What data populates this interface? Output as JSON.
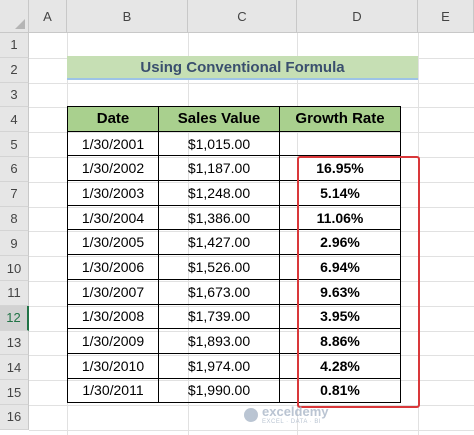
{
  "columns": [
    "A",
    "B",
    "C",
    "D",
    "E"
  ],
  "rows": [
    "1",
    "2",
    "3",
    "4",
    "5",
    "6",
    "7",
    "8",
    "9",
    "10",
    "11",
    "12",
    "13",
    "14",
    "15",
    "16"
  ],
  "selected_row": "12",
  "title": "Using Conventional Formula",
  "table": {
    "headers": [
      "Date",
      "Sales Value",
      "Growth Rate"
    ],
    "rows": [
      {
        "date": "1/30/2001",
        "sales": "$1,015.00",
        "growth": ""
      },
      {
        "date": "1/30/2002",
        "sales": "$1,187.00",
        "growth": "16.95%"
      },
      {
        "date": "1/30/2003",
        "sales": "$1,248.00",
        "growth": "5.14%"
      },
      {
        "date": "1/30/2004",
        "sales": "$1,386.00",
        "growth": "11.06%"
      },
      {
        "date": "1/30/2005",
        "sales": "$1,427.00",
        "growth": "2.96%"
      },
      {
        "date": "1/30/2006",
        "sales": "$1,526.00",
        "growth": "6.94%"
      },
      {
        "date": "1/30/2007",
        "sales": "$1,673.00",
        "growth": "9.63%"
      },
      {
        "date": "1/30/2008",
        "sales": "$1,739.00",
        "growth": "3.95%"
      },
      {
        "date": "1/30/2009",
        "sales": "$1,893.00",
        "growth": "8.86%"
      },
      {
        "date": "1/30/2010",
        "sales": "$1,974.00",
        "growth": "4.28%"
      },
      {
        "date": "1/30/2011",
        "sales": "$1,990.00",
        "growth": "0.81%"
      }
    ]
  },
  "watermark": {
    "brand": "exceldemy",
    "tagline": "EXCEL · DATA · BI"
  },
  "colors": {
    "header_fill": "#a9d08e",
    "title_fill": "#c6dfb4",
    "highlight_border": "#d9383a"
  }
}
